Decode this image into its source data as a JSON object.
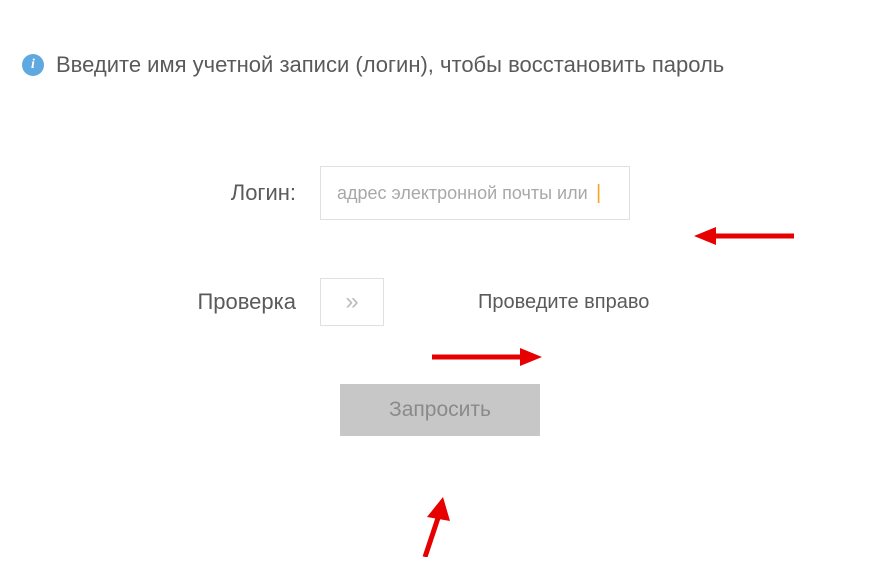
{
  "info": {
    "message": "Введите имя учетной записи (логин), чтобы восстановить пароль"
  },
  "form": {
    "login": {
      "label": "Логин:",
      "placeholder": "адрес электронной почты или "
    },
    "verify": {
      "label": "Проверка",
      "slider_hint": "Проведите вправо"
    },
    "submit_label": "Запросить"
  },
  "icons": {
    "info_glyph": "i",
    "slider_glyph": "»"
  }
}
